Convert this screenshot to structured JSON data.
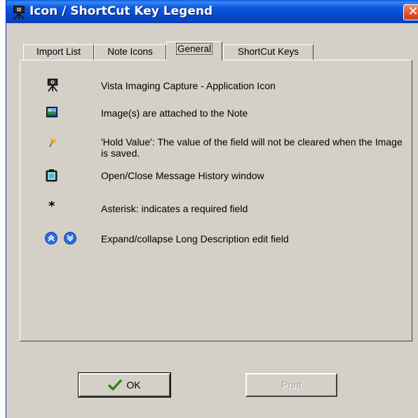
{
  "window": {
    "title": "Icon / ShortCut Key Legend",
    "close_symbol": "✕"
  },
  "tabs": [
    {
      "label": "Import List",
      "active": false
    },
    {
      "label": "Note Icons",
      "active": false
    },
    {
      "label": "General",
      "active": true
    },
    {
      "label": "ShortCut Keys",
      "active": false
    }
  ],
  "legend": [
    {
      "icon": "camera-icon",
      "text": "Vista Imaging Capture - Application Icon"
    },
    {
      "icon": "image-attached-icon",
      "text": "Image(s) are attached to the Note"
    },
    {
      "icon": "pushpin-icon",
      "text": "'Hold Value': The value of the field will not be cleared when the Image is saved."
    },
    {
      "icon": "message-history-icon",
      "text": "Open/Close Message History window"
    },
    {
      "icon": "asterisk-icon",
      "text": "Asterisk:  indicates a required field",
      "symbol": "*"
    },
    {
      "icon": "expand-collapse-icon",
      "text": "Expand/collapse Long Description edit field"
    }
  ],
  "buttons": {
    "ok_label": "OK",
    "print_label": "Print",
    "print_enabled": false
  },
  "colors": {
    "titlebar": "#0a5fe3",
    "window_bg": "#d4d0c8",
    "close_button": "#e0502a",
    "disabled_text": "#a0a0a0"
  }
}
